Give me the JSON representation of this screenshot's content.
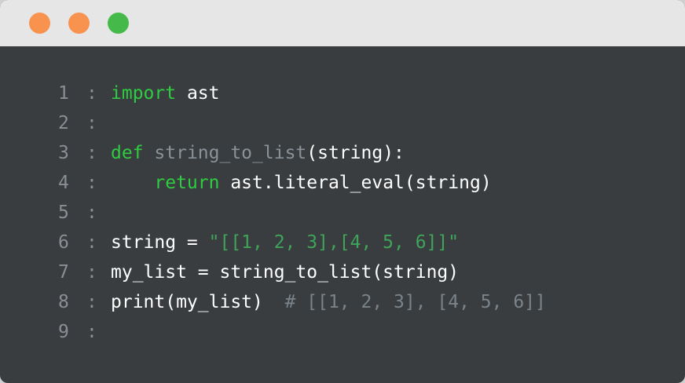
{
  "window": {
    "controls": [
      "close",
      "minimize",
      "maximize"
    ]
  },
  "code": {
    "lines": [
      {
        "num": "1",
        "sep": ":",
        "parts": [
          {
            "t": "import",
            "c": "kw"
          },
          {
            "t": " ast",
            "c": ""
          }
        ]
      },
      {
        "num": "2",
        "sep": ":",
        "parts": []
      },
      {
        "num": "3",
        "sep": ":",
        "parts": [
          {
            "t": "def",
            "c": "kw"
          },
          {
            "t": " ",
            "c": ""
          },
          {
            "t": "string_to_list",
            "c": "fn"
          },
          {
            "t": "(string):",
            "c": ""
          }
        ]
      },
      {
        "num": "4",
        "sep": ":",
        "parts": [
          {
            "t": "    ",
            "c": ""
          },
          {
            "t": "return",
            "c": "kw"
          },
          {
            "t": " ast.literal_eval(string)",
            "c": ""
          }
        ]
      },
      {
        "num": "5",
        "sep": ":",
        "parts": []
      },
      {
        "num": "6",
        "sep": ":",
        "parts": [
          {
            "t": "string = ",
            "c": ""
          },
          {
            "t": "\"[[1, 2, 3],[4, 5, 6]]\"",
            "c": "str"
          }
        ]
      },
      {
        "num": "7",
        "sep": ":",
        "parts": [
          {
            "t": "my_list = string_to_list(string)",
            "c": ""
          }
        ]
      },
      {
        "num": "8",
        "sep": ":",
        "parts": [
          {
            "t": "print(my_list)  ",
            "c": ""
          },
          {
            "t": "# [[1, 2, 3], [4, 5, 6]]",
            "c": "cm"
          }
        ]
      },
      {
        "num": "9",
        "sep": ":",
        "parts": []
      }
    ]
  },
  "colors": {
    "keyword": "#2ecc40",
    "function_name": "#8a9299",
    "string": "#3fa35a",
    "comment": "#7a8389",
    "background": "#3a3d40",
    "titlebar": "#e6e6e6"
  }
}
